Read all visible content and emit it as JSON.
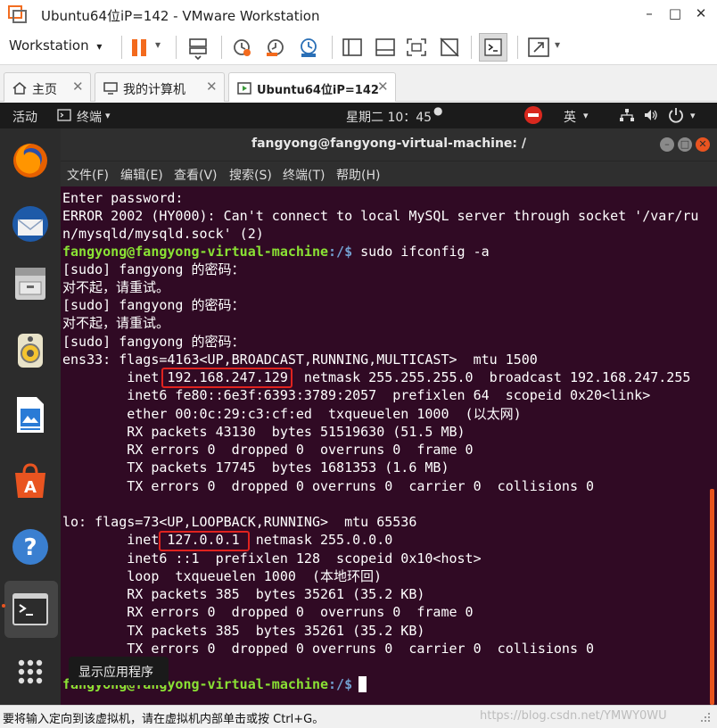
{
  "window": {
    "title": "Ubuntu64位iP=142 - VMware Workstation",
    "minimize": "–",
    "maximize": "□",
    "close": "✕"
  },
  "toolbar": {
    "workstation_label": "Workstation",
    "dropdown_glyph": "▾"
  },
  "tabs": [
    {
      "label": "主页",
      "icon": "home-icon"
    },
    {
      "label": "我的计算机",
      "icon": "monitor-icon"
    },
    {
      "label": "Ubuntu64位iP=142",
      "icon": "vm-icon"
    }
  ],
  "tab_close": "✕",
  "ubuntu_panel": {
    "activities": "活动",
    "terminal_app": "终端",
    "clock": "星期二 10：45",
    "input_method": "英",
    "arrow": "▾"
  },
  "dock": {
    "tooltip": "显示应用程序",
    "items": [
      {
        "name": "firefox-icon"
      },
      {
        "name": "thunderbird-icon"
      },
      {
        "name": "files-icon"
      },
      {
        "name": "rhythmbox-icon"
      },
      {
        "name": "libreoffice-writer-icon"
      },
      {
        "name": "software-center-icon"
      },
      {
        "name": "help-icon"
      },
      {
        "name": "terminal-icon"
      },
      {
        "name": "show-apps-icon"
      }
    ]
  },
  "terminal": {
    "title": "fangyong@fangyong-virtual-machine: /",
    "menu": [
      "文件(F)",
      "编辑(E)",
      "查看(V)",
      "搜索(S)",
      "终端(T)",
      "帮助(H)"
    ],
    "prompt_user": "fangyong@fangyong-virtual-machine",
    "prompt_path": ":/$",
    "lines": {
      "l1": "Enter password:",
      "l2": "ERROR 2002 (HY000): Can't connect to local MySQL server through socket '/var/ru",
      "l3": "n/mysqld/mysqld.sock' (2)",
      "l4_cmd": " sudo ifconfig -a",
      "l5": "[sudo] fangyong 的密码：",
      "l6": "对不起，请重试。",
      "l7": "[sudo] fangyong 的密码：",
      "l8": "对不起，请重试。",
      "l9": "[sudo] fangyong 的密码：",
      "l10": "ens33: flags=4163<UP,BROADCAST,RUNNING,MULTICAST>  mtu 1500",
      "l11": "        inet 192.168.247.129  netmask 255.255.255.0  broadcast 192.168.247.255",
      "l12": "        inet6 fe80::6e3f:6393:3789:2057  prefixlen 64  scopeid 0x20<link>",
      "l13": "        ether 00:0c:29:c3:cf:ed  txqueuelen 1000  (以太网)",
      "l14": "        RX packets 43130  bytes 51519630 (51.5 MB)",
      "l15": "        RX errors 0  dropped 0  overruns 0  frame 0",
      "l16": "        TX packets 17745  bytes 1681353 (1.6 MB)",
      "l17": "        TX errors 0  dropped 0 overruns 0  carrier 0  collisions 0",
      "l18": "lo: flags=73<UP,LOOPBACK,RUNNING>  mtu 65536",
      "l19": "        inet 127.0.0.1  netmask 255.0.0.0",
      "l20": "        inet6 ::1  prefixlen 128  scopeid 0x10<host>",
      "l21": "        loop  txqueuelen 1000  (本地环回)",
      "l22": "        RX packets 385  bytes 35261 (35.2 KB)",
      "l23": "        RX errors 0  dropped 0  overruns 0  frame 0",
      "l24": "        TX packets 385  bytes 35261 (35.2 KB)",
      "l25": "        TX errors 0  dropped 0 overruns 0  carrier 0  collisions 0"
    }
  },
  "statusbar": {
    "message": "要将输入定向到该虚拟机，请在虚拟机内部单击或按 Ctrl+G。",
    "watermark": "https://blog.csdn.net/YMWY0WU"
  },
  "colors": {
    "terminal_bg": "#300a24",
    "prompt_user": "#8ae234",
    "prompt_path": "#729fcf",
    "highlight": "#e0231f",
    "pause_orange": "#f36a1d"
  }
}
